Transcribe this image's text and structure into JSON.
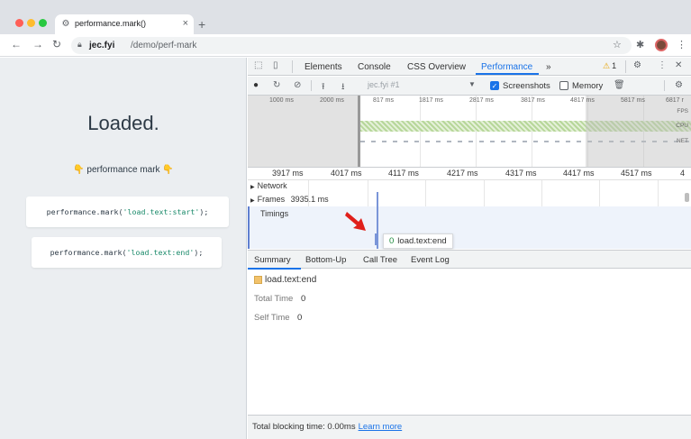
{
  "browser": {
    "tab_title": "performance.mark()",
    "new_tab": "+",
    "url_host": "jec.fyi",
    "url_path": "/demo/perf-mark"
  },
  "page": {
    "heading": "Loaded.",
    "subtitle": "👇 performance mark 👇",
    "code_lines": [
      {
        "fn": "performance.mark(",
        "arg": "'load.text:start'",
        "end": ");"
      },
      {
        "fn": "performance.mark(",
        "arg": "'load.text:end'",
        "end": ");"
      }
    ]
  },
  "devtools": {
    "tabs": [
      "Elements",
      "Console",
      "CSS Overview",
      "Performance",
      "»"
    ],
    "active_tab": "Performance",
    "warning_count": "1",
    "recording_select": "jec.fyi #1",
    "screenshots_label": "Screenshots",
    "memory_label": "Memory",
    "overview_ticks": [
      "1000 ms",
      "2000 ms",
      "817 ms",
      "1817 ms",
      "2817 ms",
      "3817 ms",
      "4817 ms",
      "5817 ms",
      "6817 r"
    ],
    "overview_labels": [
      "FPS",
      "CPU",
      "NET"
    ],
    "ruler_ticks": [
      "3917 ms",
      "4017 ms",
      "4117 ms",
      "4217 ms",
      "4317 ms",
      "4417 ms",
      "4517 ms",
      "4"
    ],
    "tracks": {
      "network": "Network",
      "frames": "Frames",
      "frames_value": "3935.1 ms",
      "timings": "Timings"
    },
    "tooltip": {
      "ms": "0",
      "label": "load.text:end"
    },
    "bottom_tabs": [
      "Summary",
      "Bottom-Up",
      "Call Tree",
      "Event Log"
    ],
    "summary": {
      "name": "load.text:end",
      "total_time_label": "Total Time",
      "total_time_value": "0",
      "self_time_label": "Self Time",
      "self_time_value": "0"
    },
    "status": {
      "text": "Total blocking time: 0.00ms",
      "link": "Learn more"
    }
  },
  "colors": {
    "accent": "#1a73e8",
    "marker_arrow": "#e0201b",
    "summary_swatch": "#f2c26b"
  }
}
